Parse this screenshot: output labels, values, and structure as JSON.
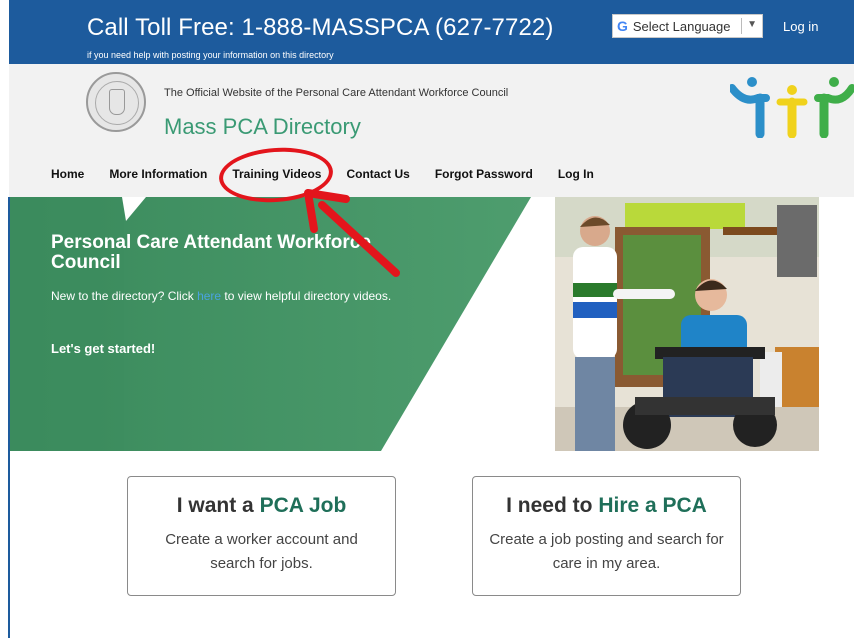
{
  "topbar": {
    "toll_free": "Call Toll Free: 1-888-MASSPCA (627-7722)",
    "toll_sub": "if you need help with posting your information on this directory",
    "language_label": "Select Language",
    "login_label": "Log in"
  },
  "header": {
    "tagline": "The Official Website of the Personal Care Attendant Workforce Council",
    "brand": "Mass PCA Directory"
  },
  "nav": {
    "items": [
      {
        "label": "Home"
      },
      {
        "label": "More Information"
      },
      {
        "label": "Training Videos"
      },
      {
        "label": "Contact Us"
      },
      {
        "label": "Forgot Password"
      },
      {
        "label": "Log In"
      }
    ]
  },
  "hero": {
    "title": "Personal Care Attendant Workforce Council",
    "text_before": "New to the directory? Click ",
    "link": "here",
    "text_after": " to view helpful directory videos.",
    "cta": "Let's get started!"
  },
  "cards": [
    {
      "prefix": "I want a ",
      "highlight": "PCA Job",
      "body": "Create a worker account and search for jobs."
    },
    {
      "prefix": "I need to ",
      "highlight": "Hire a PCA",
      "body": "Create a job posting and search for care in my area."
    }
  ],
  "colors": {
    "topbar": "#1d5b9d",
    "brand": "#3a9a74",
    "hero_green": "#3d8f5f",
    "annotation": "#e3151c"
  },
  "icons": [
    "google-g-icon",
    "dropdown-arrow-icon",
    "state-seal-icon",
    "pca-logo-icon"
  ]
}
